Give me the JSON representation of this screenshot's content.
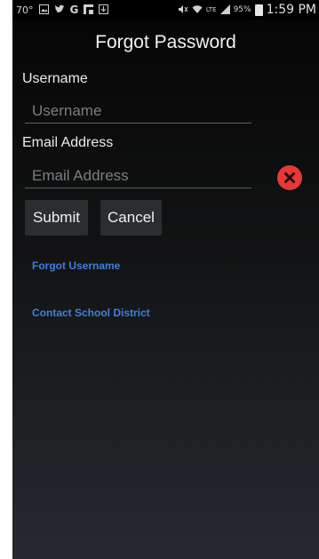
{
  "status_bar": {
    "temperature": "70°",
    "battery_percent": "95%",
    "time": "1:59 PM",
    "icons": [
      "gallery-icon",
      "twitter-icon",
      "google-icon",
      "flipboard-icon",
      "download-icon",
      "mute-icon",
      "wifi-icon",
      "lte-icon",
      "signal-icon",
      "battery-icon"
    ]
  },
  "header": {
    "title": "Forgot Password"
  },
  "form": {
    "username": {
      "label": "Username",
      "placeholder": "Username",
      "value": ""
    },
    "email": {
      "label": "Email Address",
      "placeholder": "Email Address",
      "value": ""
    },
    "error_icon_color": "#e53935"
  },
  "actions": {
    "submit_label": "Submit",
    "cancel_label": "Cancel"
  },
  "links": {
    "forgot_username": "Forgot Username",
    "contact_district": "Contact School District",
    "link_color": "#3f7fe0"
  }
}
